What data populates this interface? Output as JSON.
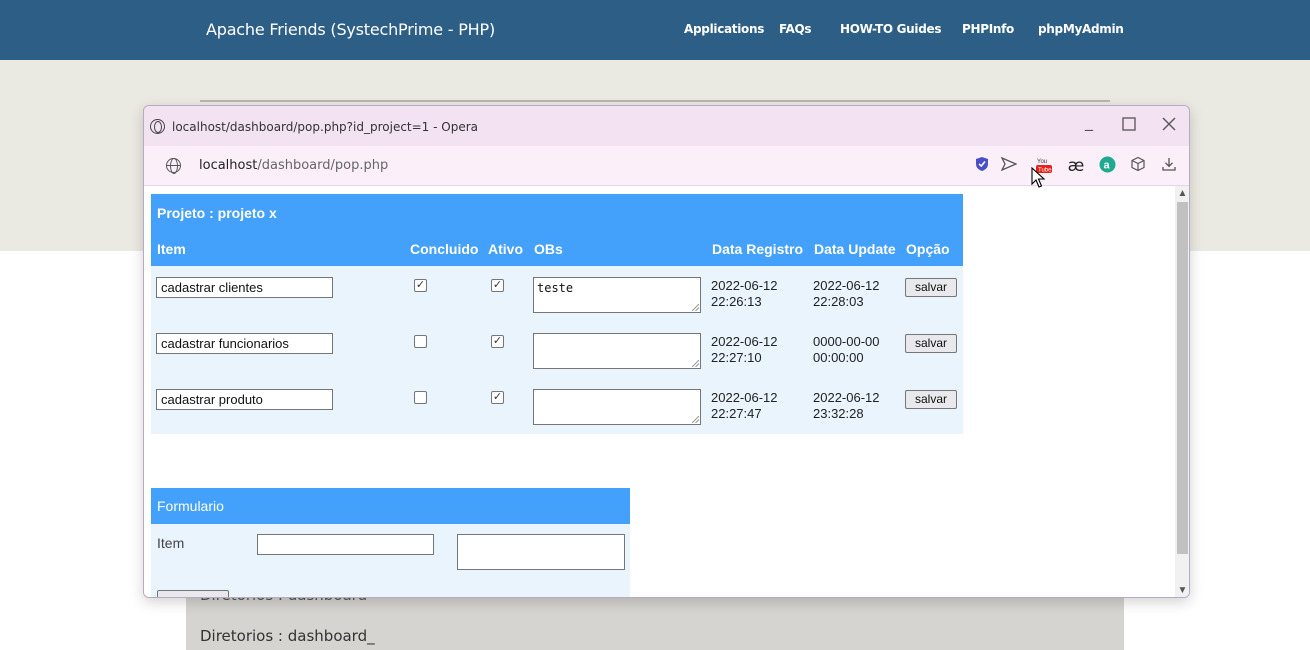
{
  "site": {
    "title": "Apache Friends (SystechPrime - PHP)",
    "nav": [
      "Applications",
      "FAQs",
      "HOW-TO Guides",
      "PHPInfo",
      "phpMyAdmin"
    ],
    "directories_ghost": "Diretorios : dashboard",
    "directories_text": "Diretorios : dashboard_"
  },
  "popup": {
    "window_title": "localhost/dashboard/pop.php?id_project=1 - Opera",
    "controls": {
      "minimize": "_",
      "maximize": "☐",
      "close": "✕"
    },
    "url_host": "localhost",
    "url_path": "/dashboard/pop.php",
    "toolbar_icons": [
      "vpn-shield-icon",
      "send-icon",
      "youtube-icon",
      "ae-icon",
      "amazon-icon",
      "cube-icon",
      "download-icon"
    ]
  },
  "project": {
    "title": "Projeto : projeto x",
    "headers": {
      "item": "Item",
      "concluido": "Concluido",
      "ativo": "Ativo",
      "obs": "OBs",
      "data_registro": "Data Registro",
      "data_update": "Data Update",
      "opcao": "Opção"
    },
    "rows": [
      {
        "item": "cadastrar clientes",
        "concluido": true,
        "ativo": true,
        "obs": "teste",
        "data_registro": "2022-06-12 22:26:13",
        "data_update": "2022-06-12 22:28:03",
        "action": "salvar"
      },
      {
        "item": "cadastrar funcionarios",
        "concluido": false,
        "ativo": true,
        "obs": "",
        "data_registro": "2022-06-12 22:27:10",
        "data_update": "0000-00-00 00:00:00",
        "action": "salvar"
      },
      {
        "item": "cadastrar produto",
        "concluido": false,
        "ativo": true,
        "obs": "",
        "data_registro": "2022-06-12 22:27:47",
        "data_update": "2022-06-12 23:32:28",
        "action": "salvar"
      }
    ]
  },
  "form": {
    "title": "Formulario",
    "item_label": "Item"
  },
  "colors": {
    "topbar": "#2d5f86",
    "table_header": "#43a0fb",
    "table_body": "#eaf4fd",
    "popup_titlebar": "#f3e2f1"
  }
}
